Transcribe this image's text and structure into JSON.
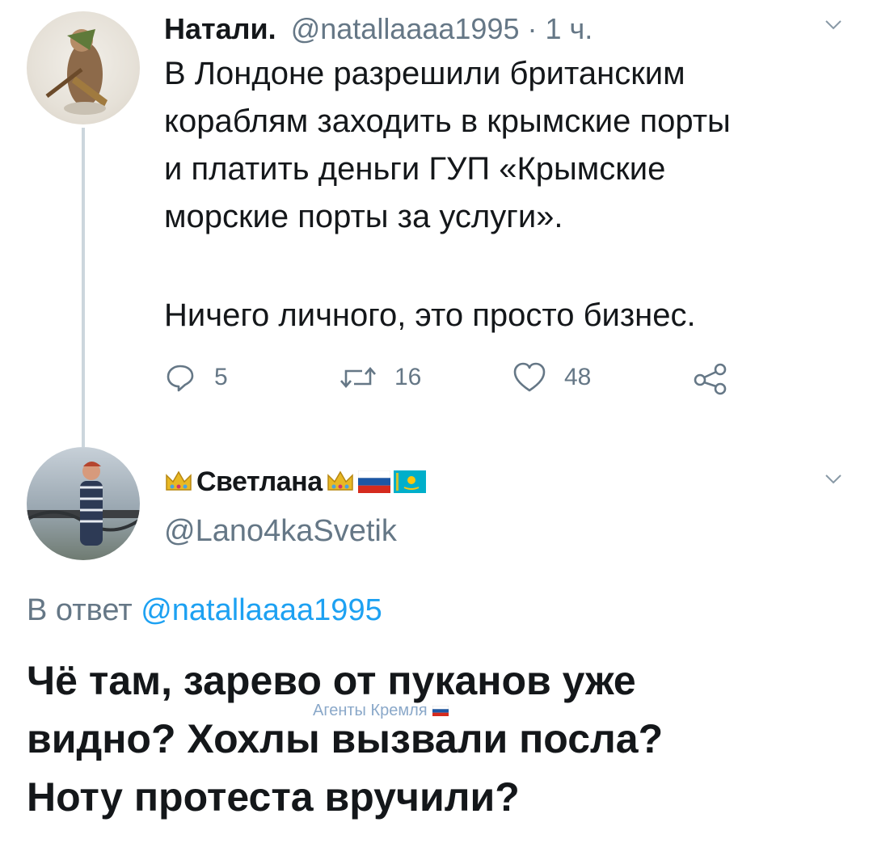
{
  "tweet1": {
    "display_name": "Натали.",
    "handle": "@natallaaaa1995",
    "separator": "·",
    "time": "1 ч.",
    "text_para1": "В Лондоне разрешили британским\nкораблям заходить в крымские порты\nи платить деньги ГУП «Крымские\nморские порты за услуги».",
    "text_para2": "Ничего личного, это просто бизнес.",
    "actions": {
      "replies": "5",
      "retweets": "16",
      "likes": "48"
    }
  },
  "tweet2": {
    "display_name": "Светлана",
    "handle": "@Lano4kaSvetik",
    "reply_prefix": "В ответ",
    "reply_handle": "@natallaaaa1995",
    "text": "Чё там, зарево от пуканов уже\nвидно? Хохлы вызвали посла?\nНоту протеста вручили?"
  },
  "watermark": "Агенты Кремля",
  "colors": {
    "text": "#14171a",
    "secondary": "#657786",
    "thread_line": "#ccd6dd"
  },
  "icons": [
    "reply-icon",
    "retweet-icon",
    "like-icon",
    "share-icon",
    "chevron-down-icon",
    "crown-icon",
    "russia-flag-icon",
    "kazakhstan-flag-icon"
  ]
}
